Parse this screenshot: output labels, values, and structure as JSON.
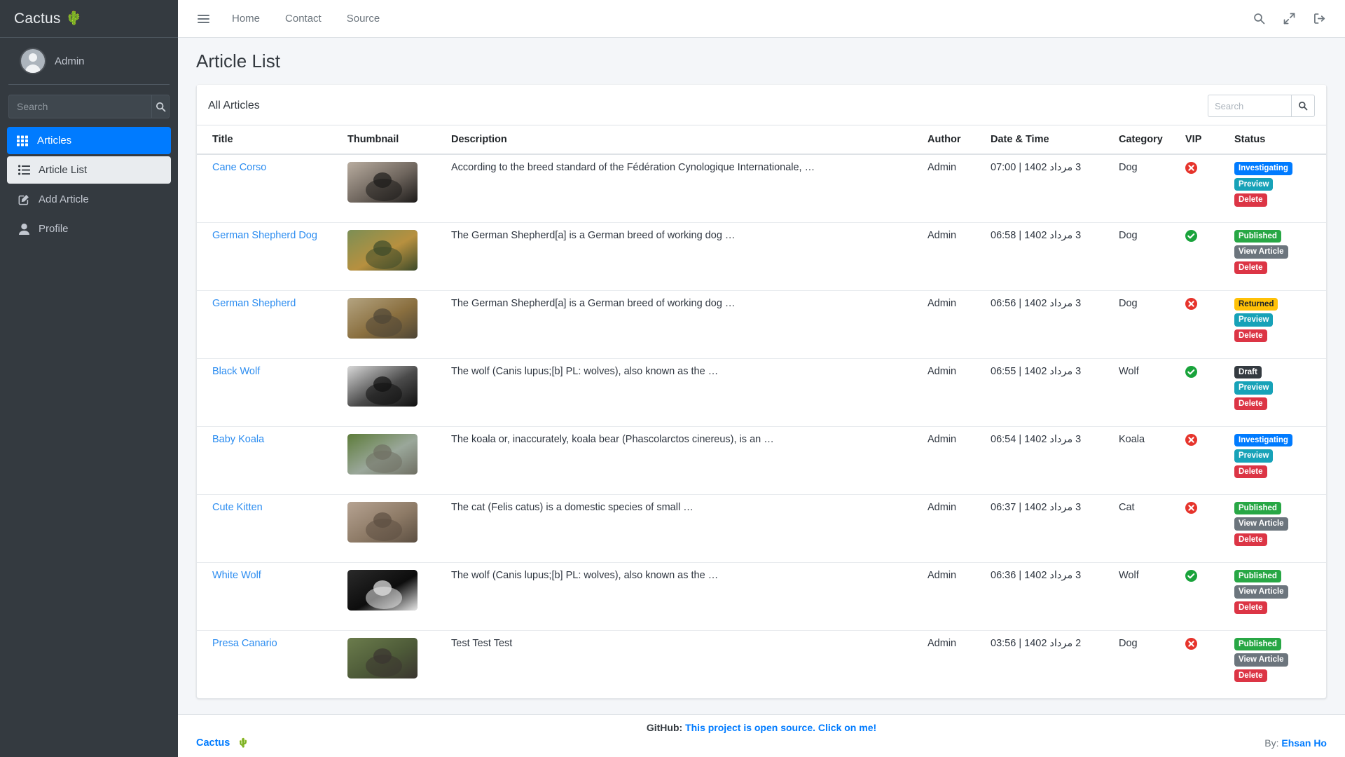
{
  "sidebar": {
    "brand": {
      "text": "Cactus",
      "emoji": "🌵"
    },
    "user": {
      "name": "Admin"
    },
    "search": {
      "placeholder": "Search",
      "value": ""
    },
    "items": [
      {
        "label": "Articles",
        "icon": "grid-icon",
        "state": "active-primary"
      },
      {
        "label": "Article List",
        "icon": "list-icon",
        "state": "active-light"
      },
      {
        "label": "Add Article",
        "icon": "edit-square-icon",
        "state": "normal"
      },
      {
        "label": "Profile",
        "icon": "user-icon",
        "state": "normal"
      }
    ]
  },
  "topbar": {
    "menu_icon": "hamburger-icon",
    "links": [
      "Home",
      "Contact",
      "Source"
    ],
    "icons": [
      "search-icon",
      "expand-icon",
      "logout-icon"
    ]
  },
  "page": {
    "title": "Article List"
  },
  "card": {
    "title": "All Articles",
    "search": {
      "placeholder": "Search",
      "value": ""
    },
    "search_icon": "search-icon"
  },
  "table": {
    "columns": [
      "Title",
      "Thumbnail",
      "Description",
      "Author",
      "Date & Time",
      "Category",
      "VIP",
      "Status"
    ],
    "rows": [
      {
        "title": "Cane Corso",
        "thumb": "cane-corso-thumbnail",
        "description": "According to the breed standard of the Fédération Cynologique Internationale, …",
        "author": "Admin",
        "date": "3 مرداد 1402 | 07:00",
        "category": "Dog",
        "vip": false,
        "badges": [
          {
            "label": "Investigating",
            "kind": "b-investigating"
          },
          {
            "label": "Preview",
            "kind": "b-preview"
          },
          {
            "label": "Delete",
            "kind": "b-delete"
          }
        ]
      },
      {
        "title": "German Shepherd Dog",
        "thumb": "german-shepherd-dog-thumbnail",
        "description": "The German Shepherd[a] is a German breed of working dog …",
        "author": "Admin",
        "date": "3 مرداد 1402 | 06:58",
        "category": "Dog",
        "vip": true,
        "badges": [
          {
            "label": "Published",
            "kind": "b-published"
          },
          {
            "label": "View Article",
            "kind": "b-view"
          },
          {
            "label": "Delete",
            "kind": "b-delete"
          }
        ]
      },
      {
        "title": "German Shepherd",
        "thumb": "german-shepherd-thumbnail",
        "description": "The German Shepherd[a] is a German breed of working dog …",
        "author": "Admin",
        "date": "3 مرداد 1402 | 06:56",
        "category": "Dog",
        "vip": false,
        "badges": [
          {
            "label": "Returned",
            "kind": "b-returned"
          },
          {
            "label": "Preview",
            "kind": "b-preview"
          },
          {
            "label": "Delete",
            "kind": "b-delete"
          }
        ]
      },
      {
        "title": "Black Wolf",
        "thumb": "black-wolf-thumbnail",
        "description": "The wolf (Canis lupus;[b] PL: wolves), also known as the …",
        "author": "Admin",
        "date": "3 مرداد 1402 | 06:55",
        "category": "Wolf",
        "vip": true,
        "badges": [
          {
            "label": "Draft",
            "kind": "b-draft"
          },
          {
            "label": "Preview",
            "kind": "b-preview"
          },
          {
            "label": "Delete",
            "kind": "b-delete"
          }
        ]
      },
      {
        "title": "Baby Koala",
        "thumb": "baby-koala-thumbnail",
        "description": "The koala or, inaccurately, koala bear (Phascolarctos cinereus), is an …",
        "author": "Admin",
        "date": "3 مرداد 1402 | 06:54",
        "category": "Koala",
        "vip": false,
        "badges": [
          {
            "label": "Investigating",
            "kind": "b-investigating"
          },
          {
            "label": "Preview",
            "kind": "b-preview"
          },
          {
            "label": "Delete",
            "kind": "b-delete"
          }
        ]
      },
      {
        "title": "Cute Kitten",
        "thumb": "cute-kitten-thumbnail",
        "description": "The cat (Felis catus) is a domestic species of small …",
        "author": "Admin",
        "date": "3 مرداد 1402 | 06:37",
        "category": "Cat",
        "vip": false,
        "badges": [
          {
            "label": "Published",
            "kind": "b-published"
          },
          {
            "label": "View Article",
            "kind": "b-view"
          },
          {
            "label": "Delete",
            "kind": "b-delete"
          }
        ]
      },
      {
        "title": "White Wolf",
        "thumb": "white-wolf-thumbnail",
        "description": "The wolf (Canis lupus;[b] PL: wolves), also known as the …",
        "author": "Admin",
        "date": "3 مرداد 1402 | 06:36",
        "category": "Wolf",
        "vip": true,
        "badges": [
          {
            "label": "Published",
            "kind": "b-published"
          },
          {
            "label": "View Article",
            "kind": "b-view"
          },
          {
            "label": "Delete",
            "kind": "b-delete"
          }
        ]
      },
      {
        "title": "Presa Canario",
        "thumb": "presa-canario-thumbnail",
        "description": "Test Test Test",
        "author": "Admin",
        "date": "2 مرداد 1402 | 03:56",
        "category": "Dog",
        "vip": false,
        "badges": [
          {
            "label": "Published",
            "kind": "b-published"
          },
          {
            "label": "View Article",
            "kind": "b-view"
          },
          {
            "label": "Delete",
            "kind": "b-delete"
          }
        ]
      }
    ]
  },
  "footer": {
    "github_label": "GitHub:",
    "github_link": "This project is open source. Click on me!",
    "brand": "Cactus",
    "brand_emoji": "🌵",
    "by_label": "By:",
    "by_name": "Ehsan Ho"
  },
  "colors": {
    "sidebar_bg": "#343a40",
    "primary": "#007bff",
    "link": "#2b8cf0",
    "success": "#28a745",
    "warning": "#ffc107",
    "danger": "#dc3545",
    "info": "#17a2b8",
    "secondary": "#6c757d",
    "dark": "#343a40"
  }
}
